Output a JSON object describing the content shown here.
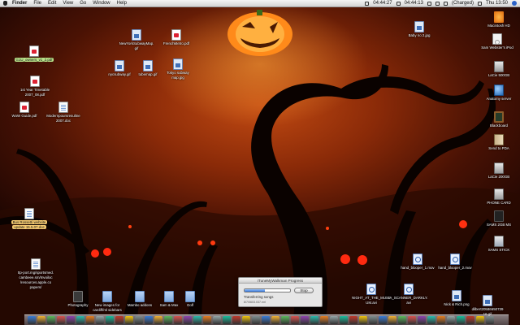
{
  "menubar": {
    "app": "Finder",
    "items": [
      "File",
      "Edit",
      "View",
      "Go",
      "Window",
      "Help"
    ],
    "clock1": "04:44:27",
    "clock2": "04:44:13",
    "battery": "(Charged)",
    "datetime": "Thu 13:50"
  },
  "desktop_icons": {
    "tl_zip": "G1U_owners_v1_2.pdf",
    "tl_timetable_l1": "1st Year Timetable",
    "tl_timetable_l2": "2007_08.pdf",
    "tl_wow": "WoW Guide.pdf",
    "tl_modernism_l1": "Modernpoursresultne",
    "tl_modernism_l2": "2007.doc",
    "ny_subway_l1": "NewYorkSubwayMap.",
    "ny_subway_l2": "gif",
    "french_metro": "FrenchMetro.pdf",
    "nycsubway": "nycsubway.gif",
    "tubemap": "tubemap.gif",
    "tokyo_l1": "Tokyo subway",
    "tokyo_l2": "map.jpg",
    "baby": "Baby no 2.jpg",
    "bus_l1": "Bus Rossetti website",
    "bus_l2": "update 15.5.07.doc",
    "webloc_l1": "ttp-port.mg/sportsmed.",
    "webloc_l2": "cambeee.sm/Invoiloc",
    "webloc_l3": "/resources.apple.co",
    "webloc_l4": "papers/",
    "photography": "Photography",
    "new_images_l1": "New images for",
    "new_images_l2": "cardiff/ml sidebars",
    "mambo": "Mambo addons",
    "sam_max": "Sam & Max",
    "golf": "Golf",
    "night_l1": "NIGHT_AT_THE_MUSE",
    "night_l2": "UM.avi",
    "scanner_l1": "A_SCANNER_DARKLY.",
    "scanner_l2": "avi",
    "blooper1": "hand_blooper_1.mov",
    "blooper2": "hand_blooper_2.mov",
    "nick": "Nick & Rich.png",
    "dilbert_l1": "dilbert20586650739",
    "dilbert_l2": "16.gif"
  },
  "right_column": [
    {
      "label": "Macintosh HD",
      "icon": "pumpkin-icon"
    },
    {
      "label": "Sam Webster's iPod",
      "icon": "ipod-icon"
    },
    {
      "label": "LaCie 500GB",
      "icon": "drive-icon"
    },
    {
      "label": "Anatomy server",
      "icon": "globe-icon"
    },
    {
      "label": "Blackboard",
      "icon": "chalkboard-icon"
    },
    {
      "label": "Send to PDA",
      "icon": "book-icon"
    },
    {
      "label": "LaCie 200GB",
      "icon": "drive-icon"
    },
    {
      "label": "PHONE CARD",
      "icon": "drive-icon"
    },
    {
      "label": "SAMS 2GB MS",
      "icon": "phone-icon"
    },
    {
      "label": "SAMS STICK",
      "icon": "robot-icon"
    }
  ],
  "progress_window": {
    "title": "iTuneMyWalkman Progress",
    "stop_label": "Stop",
    "status": "Transferring songs",
    "detail": "8/7/0603.037.mrl",
    "progress": 0.45
  },
  "colors": {
    "sky_glow": "#c24a12",
    "eye_red": "#ff2a10",
    "pumpkin": "#ff9a2a"
  }
}
